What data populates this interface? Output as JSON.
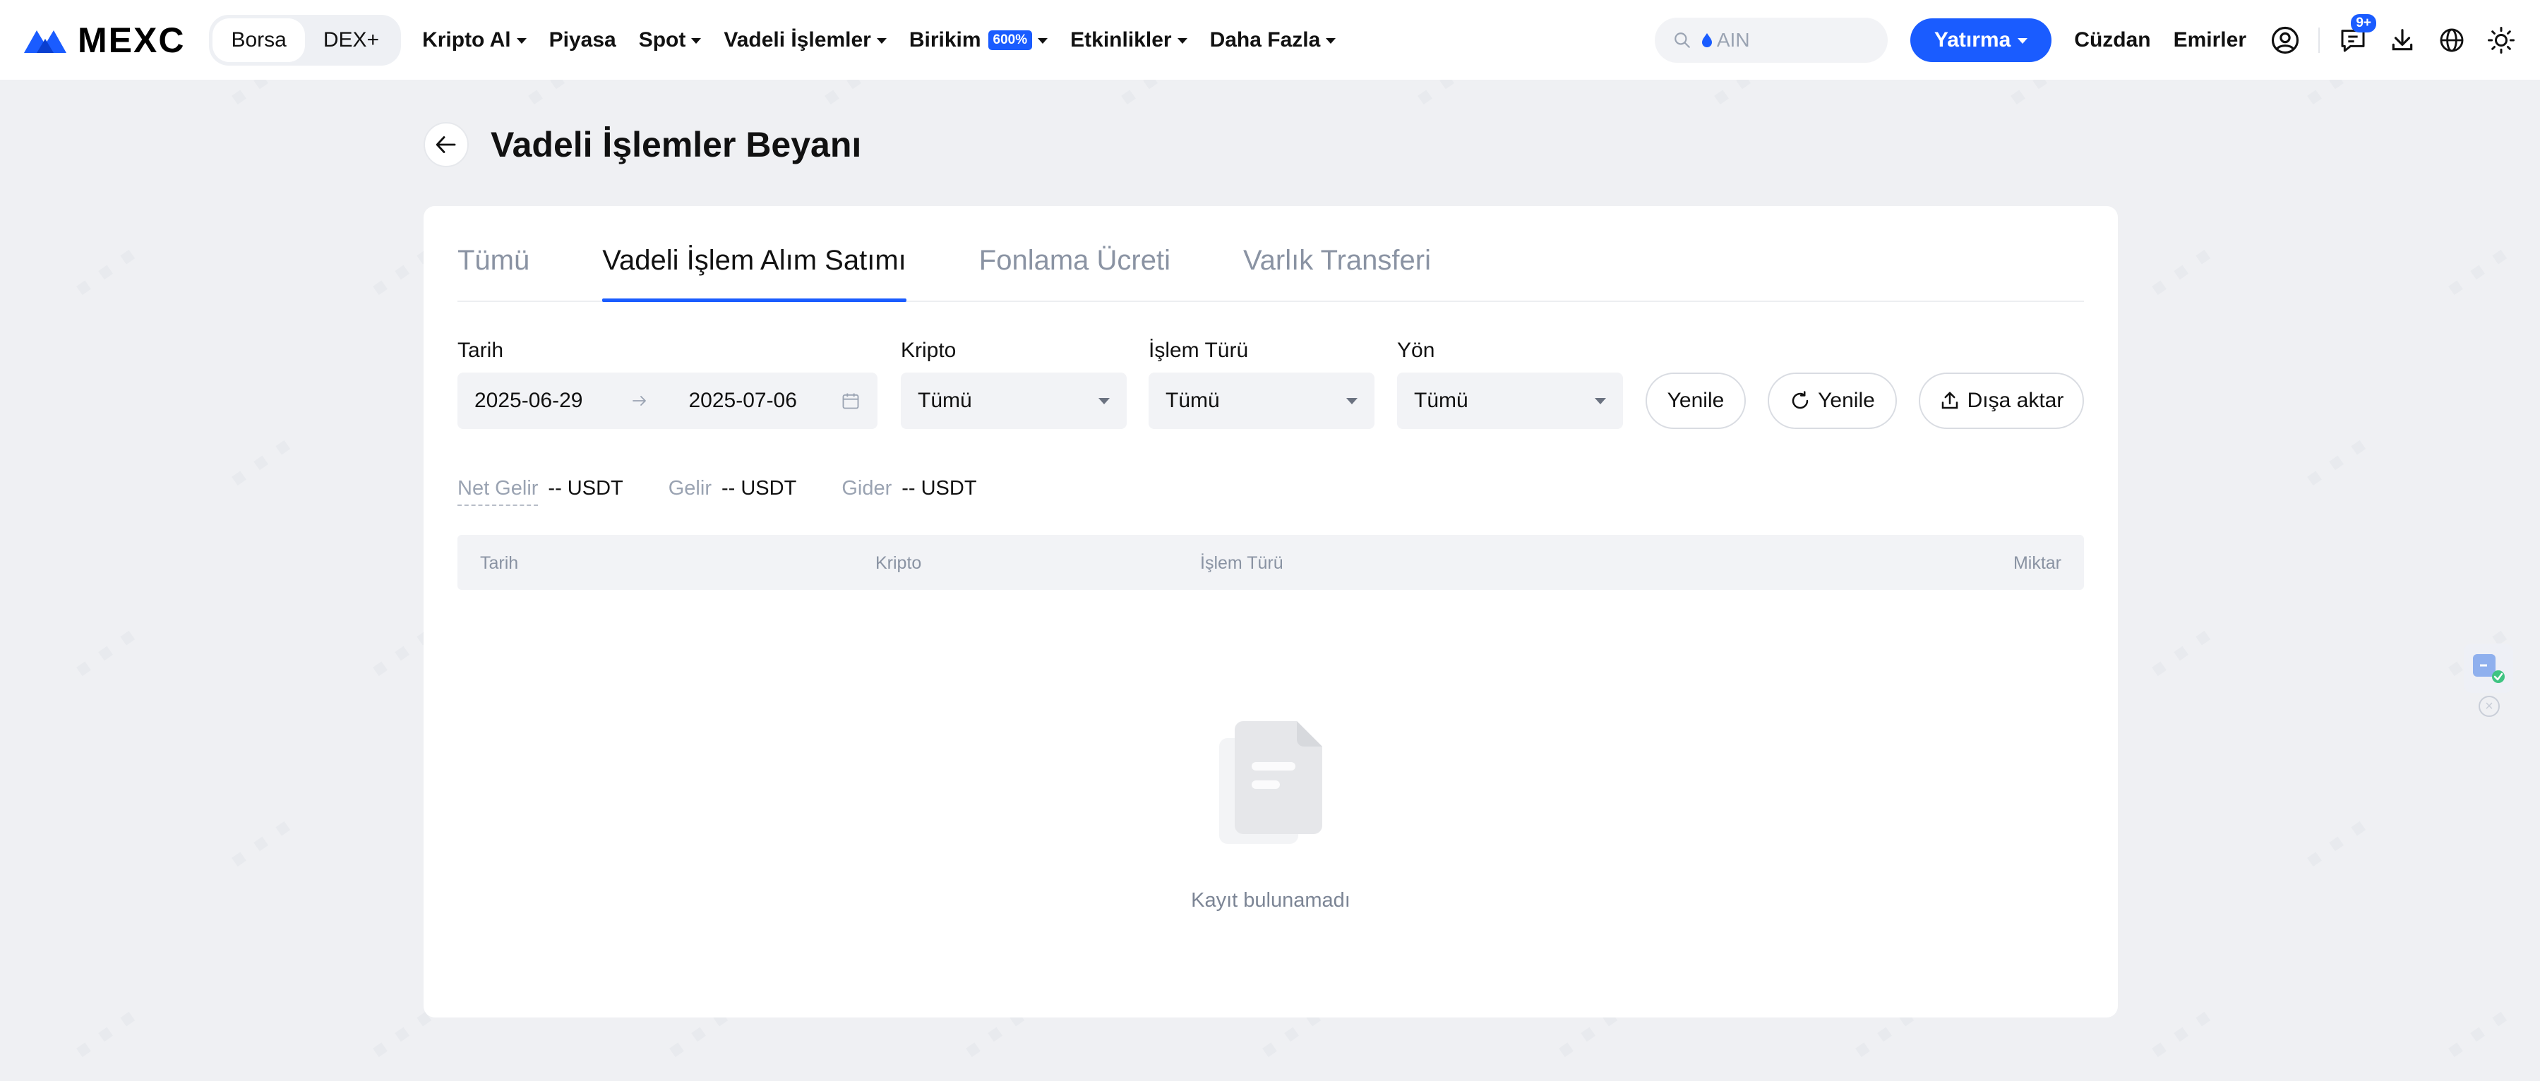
{
  "header": {
    "logo_text": "MEXC",
    "segments": [
      {
        "label": "Borsa",
        "active": true
      },
      {
        "label": "DEX+",
        "active": false
      }
    ],
    "nav": [
      {
        "label": "Kripto Al",
        "dropdown": true
      },
      {
        "label": "Piyasa",
        "dropdown": false
      },
      {
        "label": "Spot",
        "dropdown": true
      },
      {
        "label": "Vadeli İşlemler",
        "dropdown": true
      },
      {
        "label": "Birikim",
        "dropdown": true,
        "badge": "600%"
      },
      {
        "label": "Etkinlikler",
        "dropdown": true
      },
      {
        "label": "Daha Fazla",
        "dropdown": true
      }
    ],
    "search_placeholder": "AIN",
    "deposit_label": "Yatırma",
    "wallet_label": "Cüzdan",
    "orders_label": "Emirler",
    "notification_count": "9+",
    "accent_color": "#1a5cff"
  },
  "page": {
    "title": "Vadeli İşlemler Beyanı"
  },
  "tabs": [
    {
      "label": "Tümü",
      "active": false
    },
    {
      "label": "Vadeli İşlem Alım Satımı",
      "active": true
    },
    {
      "label": "Fonlama Ücreti",
      "active": false
    },
    {
      "label": "Varlık Transferi",
      "active": false
    }
  ],
  "filters": {
    "date_label": "Tarih",
    "date_start": "2025-06-29",
    "date_end": "2025-07-06",
    "crypto_label": "Kripto",
    "crypto_value": "Tümü",
    "type_label": "İşlem Türü",
    "type_value": "Tümü",
    "direction_label": "Yön",
    "direction_value": "Tümü",
    "reset_label": "Yenile",
    "refresh_label": "Yenile",
    "export_label": "Dışa aktar"
  },
  "summary": {
    "net_label": "Net Gelir",
    "net_value": "-- USDT",
    "income_label": "Gelir",
    "income_value": "-- USDT",
    "expense_label": "Gider",
    "expense_value": "-- USDT"
  },
  "table": {
    "columns": [
      "Tarih",
      "Kripto",
      "İşlem Türü",
      "Miktar"
    ],
    "rows": []
  },
  "empty": {
    "message": "Kayıt bulunamadı"
  }
}
